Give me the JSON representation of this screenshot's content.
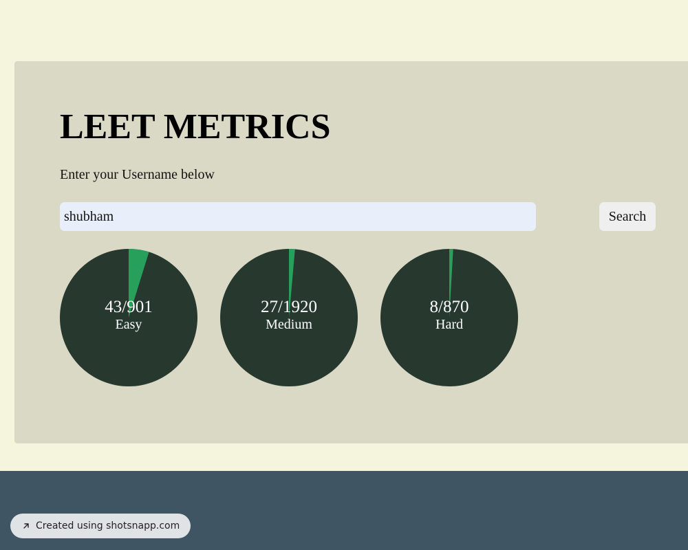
{
  "colors": {
    "page_background": "#f5f4dc",
    "card_background": "#dad9c5",
    "input_background": "#e8effa",
    "ring_base": "#27392e",
    "ring_progress": "#26a05a",
    "footer_background": "#3f5563"
  },
  "header": {
    "title": "LEET METRICS",
    "subtitle": "Enter your Username below"
  },
  "search": {
    "value": "shubham",
    "placeholder": "",
    "button_label": "Search"
  },
  "stats": [
    {
      "count_label": "43/901",
      "label": "Easy",
      "solved": 43,
      "total": 901
    },
    {
      "count_label": "27/1920",
      "label": "Medium",
      "solved": 27,
      "total": 1920
    },
    {
      "count_label": "8/870",
      "label": "Hard",
      "solved": 8,
      "total": 870
    }
  ],
  "footer": {
    "badge_icon": "arrow-up-right-icon",
    "badge_text": "Created using shotsnapp.com"
  }
}
